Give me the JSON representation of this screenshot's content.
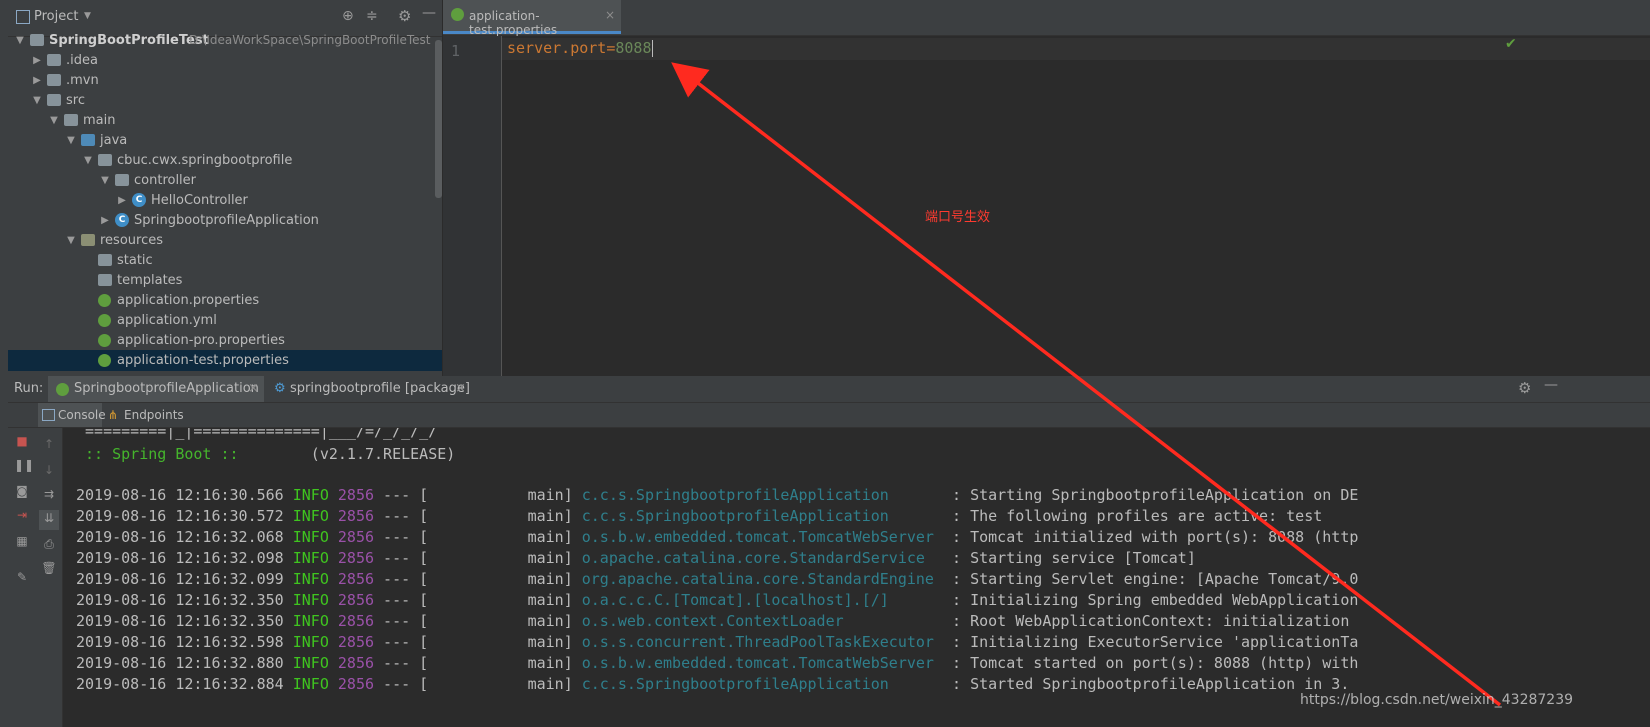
{
  "project": {
    "title": "Project",
    "tree": [
      {
        "label": "SpringBootProfileTest",
        "path": "D:\\IdeaWorkSpace\\SpringBootProfileTest",
        "depth": 0,
        "arrow": "down",
        "icon": "folder",
        "bold": true
      },
      {
        "label": ".idea",
        "depth": 1,
        "arrow": "right",
        "icon": "folder"
      },
      {
        "label": ".mvn",
        "depth": 1,
        "arrow": "right",
        "icon": "folder"
      },
      {
        "label": "src",
        "depth": 1,
        "arrow": "down",
        "icon": "folder"
      },
      {
        "label": "main",
        "depth": 2,
        "arrow": "down",
        "icon": "folder"
      },
      {
        "label": "java",
        "depth": 3,
        "arrow": "down",
        "icon": "folder-blue"
      },
      {
        "label": "cbuc.cwx.springbootprofile",
        "depth": 4,
        "arrow": "down",
        "icon": "folder"
      },
      {
        "label": "controller",
        "depth": 5,
        "arrow": "down",
        "icon": "folder"
      },
      {
        "label": "HelloController",
        "depth": 6,
        "arrow": "right",
        "icon": "class"
      },
      {
        "label": "SpringbootprofileApplication",
        "depth": 5,
        "arrow": "right",
        "icon": "class"
      },
      {
        "label": "resources",
        "depth": 3,
        "arrow": "down",
        "icon": "folder-res"
      },
      {
        "label": "static",
        "depth": 4,
        "arrow": "",
        "icon": "folder"
      },
      {
        "label": "templates",
        "depth": 4,
        "arrow": "",
        "icon": "folder"
      },
      {
        "label": "application.properties",
        "depth": 4,
        "arrow": "",
        "icon": "spring"
      },
      {
        "label": "application.yml",
        "depth": 4,
        "arrow": "",
        "icon": "spring"
      },
      {
        "label": "application-pro.properties",
        "depth": 4,
        "arrow": "",
        "icon": "spring"
      },
      {
        "label": "application-test.properties",
        "depth": 4,
        "arrow": "",
        "icon": "spring",
        "selected": true
      }
    ]
  },
  "editor": {
    "tab_label": "application-test.properties",
    "tab_close": "×",
    "line_number": "1",
    "code_key": "server.port",
    "code_eq": "=",
    "code_val": "8088",
    "annotation": "端口号生效"
  },
  "run": {
    "label": "Run:",
    "tabs": [
      {
        "label": "SpringbootprofileApplication",
        "close": "×"
      },
      {
        "label": "springbootprofile [package]",
        "close": "×"
      }
    ],
    "sub_tabs": [
      "Console",
      "Endpoints"
    ],
    "banner_line1": " =========|_|==============|___/=/_/_/_/",
    "banner_spring": " :: Spring Boot :: ",
    "banner_version": "       (v2.1.7.RELEASE)",
    "logs": [
      {
        "ts": "2019-08-16 12:16:30.566",
        "level": "INFO",
        "pid": "2856",
        "thread": "main",
        "logger": "c.c.s.SpringbootprofileApplication      ",
        "msg": ": Starting SpringbootprofileApplication on DE"
      },
      {
        "ts": "2019-08-16 12:16:30.572",
        "level": "INFO",
        "pid": "2856",
        "thread": "main",
        "logger": "c.c.s.SpringbootprofileApplication      ",
        "msg": ": The following profiles are active: test"
      },
      {
        "ts": "2019-08-16 12:16:32.068",
        "level": "INFO",
        "pid": "2856",
        "thread": "main",
        "logger": "o.s.b.w.embedded.tomcat.TomcatWebServer ",
        "msg": ": Tomcat initialized with port(s): 8088 (http"
      },
      {
        "ts": "2019-08-16 12:16:32.098",
        "level": "INFO",
        "pid": "2856",
        "thread": "main",
        "logger": "o.apache.catalina.core.StandardService  ",
        "msg": ": Starting service [Tomcat]"
      },
      {
        "ts": "2019-08-16 12:16:32.099",
        "level": "INFO",
        "pid": "2856",
        "thread": "main",
        "logger": "org.apache.catalina.core.StandardEngine ",
        "msg": ": Starting Servlet engine: [Apache Tomcat/9.0"
      },
      {
        "ts": "2019-08-16 12:16:32.350",
        "level": "INFO",
        "pid": "2856",
        "thread": "main",
        "logger": "o.a.c.c.C.[Tomcat].[localhost].[/]      ",
        "msg": ": Initializing Spring embedded WebApplication"
      },
      {
        "ts": "2019-08-16 12:16:32.350",
        "level": "INFO",
        "pid": "2856",
        "thread": "main",
        "logger": "o.s.web.context.ContextLoader           ",
        "msg": ": Root WebApplicationContext: initialization"
      },
      {
        "ts": "2019-08-16 12:16:32.598",
        "level": "INFO",
        "pid": "2856",
        "thread": "main",
        "logger": "o.s.s.concurrent.ThreadPoolTaskExecutor ",
        "msg": ": Initializing ExecutorService 'applicationTa"
      },
      {
        "ts": "2019-08-16 12:16:32.880",
        "level": "INFO",
        "pid": "2856",
        "thread": "main",
        "logger": "o.s.b.w.embedded.tomcat.TomcatWebServer ",
        "msg": ": Tomcat started on port(s): 8088 (http) with"
      },
      {
        "ts": "2019-08-16 12:16:32.884",
        "level": "INFO",
        "pid": "2856",
        "thread": "main",
        "logger": "c.c.s.SpringbootprofileApplication      ",
        "msg": ": Started SpringbootprofileApplication in 3."
      }
    ]
  },
  "watermark": "https://blog.csdn.net/weixin_43287239",
  "colors": {
    "annotation": "#ff2a1f",
    "selection": "#0d293e",
    "info": "#3fc51f",
    "pid": "#9a51a8"
  }
}
